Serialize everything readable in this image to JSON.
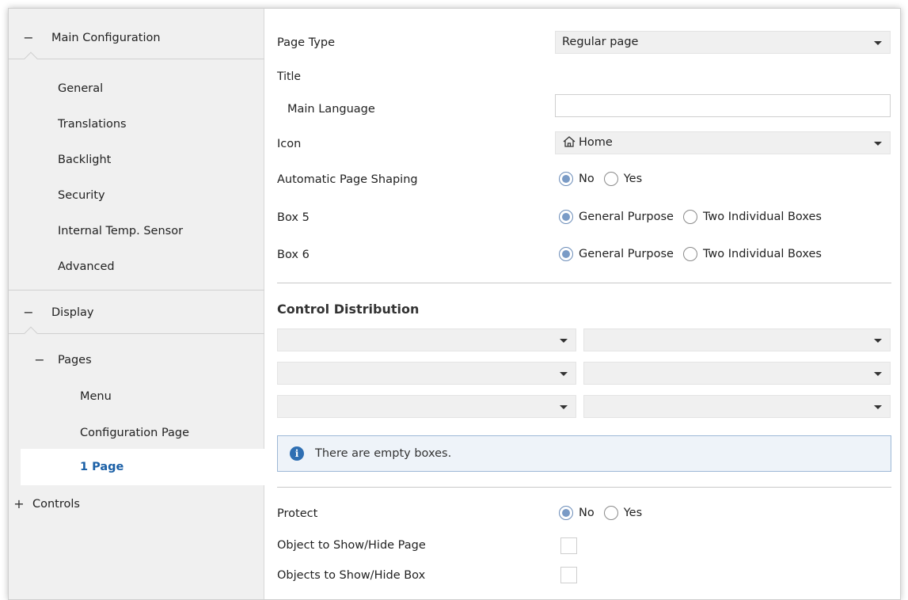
{
  "sidebar": {
    "main_configuration": {
      "sign": "−",
      "label": "Main Configuration"
    },
    "items": [
      {
        "label": "General"
      },
      {
        "label": "Translations"
      },
      {
        "label": "Backlight"
      },
      {
        "label": "Security"
      },
      {
        "label": "Internal Temp. Sensor"
      },
      {
        "label": "Advanced"
      }
    ],
    "display": {
      "sign": "−",
      "label": "Display"
    },
    "pages": {
      "sign": "−",
      "label": "Pages"
    },
    "page_items": [
      {
        "label": "Menu"
      },
      {
        "label": "Configuration Page"
      },
      {
        "label": "1 Page"
      }
    ],
    "controls": {
      "sign": "+",
      "label": "Controls"
    }
  },
  "main": {
    "page_type": {
      "label": "Page Type",
      "value": "Regular page"
    },
    "title_label": "Title",
    "main_language": {
      "label": "Main Language",
      "value": ""
    },
    "icon": {
      "label": "Icon",
      "value": "Home",
      "icon": "home-icon"
    },
    "auto_shaping": {
      "label": "Automatic Page Shaping",
      "options": [
        "No",
        "Yes"
      ],
      "selected": "No"
    },
    "box5": {
      "label": "Box 5",
      "options": [
        "General Purpose",
        "Two Individual Boxes"
      ],
      "selected": "General Purpose"
    },
    "box6": {
      "label": "Box 6",
      "options": [
        "General Purpose",
        "Two Individual Boxes"
      ],
      "selected": "General Purpose"
    },
    "control_distribution": {
      "title": "Control Distribution",
      "dropdowns": [
        "",
        "",
        "",
        "",
        "",
        ""
      ]
    },
    "info_message": "There are empty boxes.",
    "protect": {
      "label": "Protect",
      "options": [
        "No",
        "Yes"
      ],
      "selected": "No"
    },
    "object_show_hide_page": {
      "label": "Object to Show/Hide Page",
      "checked": false
    },
    "objects_show_hide_box": {
      "label": "Objects to Show/Hide Box",
      "checked": false
    }
  },
  "colors": {
    "accent": "#1a5fa6",
    "radio_fill": "#7a9bc6",
    "info_bg": "#eef3f9",
    "info_border": "#9db8d6",
    "sidebar_bg": "#f0f0f0"
  }
}
